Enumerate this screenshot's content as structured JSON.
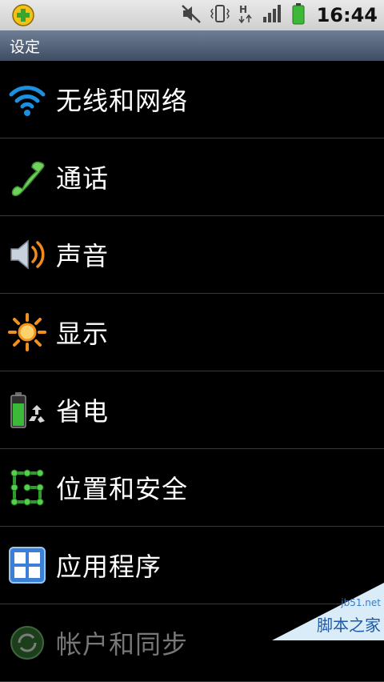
{
  "status_bar": {
    "time": "16:44",
    "icons": [
      "app-plus-icon",
      "mute-icon",
      "vibrate-icon",
      "hspa-data-icon",
      "signal-icon",
      "battery-icon"
    ]
  },
  "header": {
    "title": "设定"
  },
  "settings": {
    "items": [
      {
        "label": "无线和网络",
        "icon": "wifi-icon"
      },
      {
        "label": "通话",
        "icon": "phone-icon"
      },
      {
        "label": "声音",
        "icon": "speaker-icon"
      },
      {
        "label": "显示",
        "icon": "brightness-icon"
      },
      {
        "label": "省电",
        "icon": "battery-recycle-icon"
      },
      {
        "label": "位置和安全",
        "icon": "pattern-lock-icon"
      },
      {
        "label": "应用程序",
        "icon": "apps-grid-icon"
      },
      {
        "label": "帐户和同步",
        "icon": "sync-icon"
      }
    ]
  },
  "watermark": {
    "site": "jb51.net",
    "name": "脚本之家"
  },
  "colors": {
    "title_bar": "#4f5e75",
    "background": "#000000",
    "divider": "#3a3a3a"
  }
}
